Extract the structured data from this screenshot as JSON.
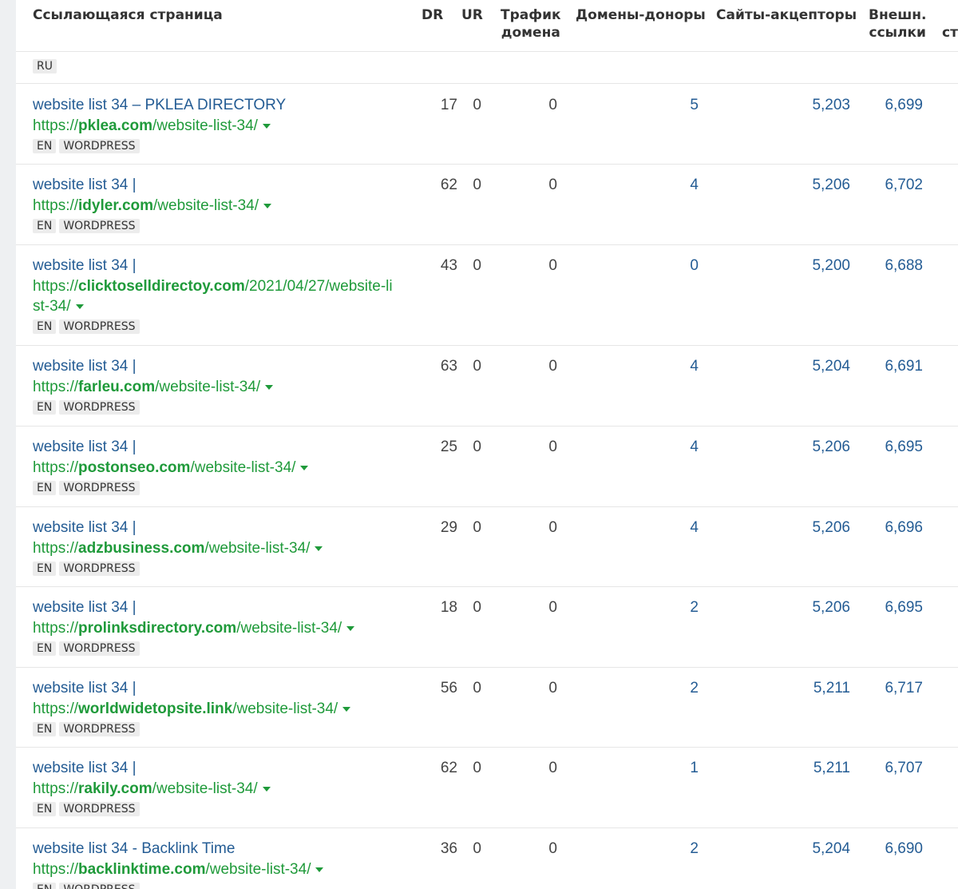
{
  "columns": {
    "page": "Ссылающаяся страница",
    "dr": "DR",
    "ur": "UR",
    "traffic_1": "Трафик",
    "traffic_2": "домена",
    "ref_domains": "Домены-доноры",
    "linked_domains": "Сайты-акцепторы",
    "ext_1": "Внешн.",
    "ext_2": "ссылки",
    "cut_2": "ст"
  },
  "language_group": "RU",
  "rows": [
    {
      "title": "website list 34 – PKLEA DIRECTORY",
      "prefix": "https://",
      "domain": "pklea.com",
      "path": "/website-list-34/",
      "lang": "EN",
      "platform": "WORDPRESS",
      "dr": "17",
      "ur": "0",
      "traffic": "0",
      "ref_domains": "5",
      "linked_domains": "5,203",
      "ext_links": "6,699"
    },
    {
      "title": "website list 34 |",
      "prefix": "https://",
      "domain": "idyler.com",
      "path": "/website-list-34/",
      "lang": "EN",
      "platform": "WORDPRESS",
      "dr": "62",
      "ur": "0",
      "traffic": "0",
      "ref_domains": "4",
      "linked_domains": "5,206",
      "ext_links": "6,702"
    },
    {
      "title": "website list 34 |",
      "prefix": "https://",
      "domain": "clicktoselldirectoy.com",
      "path": "/2021/04/27/website-list-34/",
      "lang": "EN",
      "platform": "WORDPRESS",
      "dr": "43",
      "ur": "0",
      "traffic": "0",
      "ref_domains": "0",
      "linked_domains": "5,200",
      "ext_links": "6,688"
    },
    {
      "title": "website list 34 |",
      "prefix": "https://",
      "domain": "farleu.com",
      "path": "/website-list-34/",
      "lang": "EN",
      "platform": "WORDPRESS",
      "dr": "63",
      "ur": "0",
      "traffic": "0",
      "ref_domains": "4",
      "linked_domains": "5,204",
      "ext_links": "6,691"
    },
    {
      "title": "website list 34 |",
      "prefix": "https://",
      "domain": "postonseo.com",
      "path": "/website-list-34/",
      "lang": "EN",
      "platform": "WORDPRESS",
      "dr": "25",
      "ur": "0",
      "traffic": "0",
      "ref_domains": "4",
      "linked_domains": "5,206",
      "ext_links": "6,695"
    },
    {
      "title": "website list 34 |",
      "prefix": "https://",
      "domain": "adzbusiness.com",
      "path": "/website-list-34/",
      "lang": "EN",
      "platform": "WORDPRESS",
      "dr": "29",
      "ur": "0",
      "traffic": "0",
      "ref_domains": "4",
      "linked_domains": "5,206",
      "ext_links": "6,696"
    },
    {
      "title": "website list 34 |",
      "prefix": "https://",
      "domain": "prolinksdirectory.com",
      "path": "/website-list-34/",
      "lang": "EN",
      "platform": "WORDPRESS",
      "dr": "18",
      "ur": "0",
      "traffic": "0",
      "ref_domains": "2",
      "linked_domains": "5,206",
      "ext_links": "6,695"
    },
    {
      "title": "website list 34 |",
      "prefix": "https://",
      "domain": "worldwidetopsite.link",
      "path": "/website-list-34/",
      "lang": "EN",
      "platform": "WORDPRESS",
      "dr": "56",
      "ur": "0",
      "traffic": "0",
      "ref_domains": "2",
      "linked_domains": "5,211",
      "ext_links": "6,717"
    },
    {
      "title": "website list 34 |",
      "prefix": "https://",
      "domain": "rakily.com",
      "path": "/website-list-34/",
      "lang": "EN",
      "platform": "WORDPRESS",
      "dr": "62",
      "ur": "0",
      "traffic": "0",
      "ref_domains": "1",
      "linked_domains": "5,211",
      "ext_links": "6,707"
    },
    {
      "title": "website list 34 - Backlink Time",
      "prefix": "https://",
      "domain": "backlinktime.com",
      "path": "/website-list-34/",
      "lang": "EN",
      "platform": "WORDPRESS",
      "dr": "36",
      "ur": "0",
      "traffic": "0",
      "ref_domains": "2",
      "linked_domains": "5,204",
      "ext_links": "6,690"
    }
  ]
}
